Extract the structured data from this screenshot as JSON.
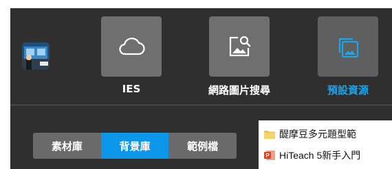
{
  "toolbar": {
    "items": [
      {
        "label": "IES",
        "icon": "cloud-icon"
      },
      {
        "label": "網路圖片搜尋",
        "icon": "image-search-icon"
      },
      {
        "label": "預設資源",
        "icon": "default-resources-icon"
      }
    ],
    "active_index": 2,
    "accent_color": "#18a6ef"
  },
  "segmented": {
    "options": [
      "素材庫",
      "背景庫",
      "範例檔"
    ],
    "active_index": 1
  },
  "files": [
    {
      "icon": "folder-icon",
      "name": "醍摩豆多元題型範"
    },
    {
      "icon": "pptx-file-icon",
      "name": "HiTeach 5新手入門"
    }
  ]
}
